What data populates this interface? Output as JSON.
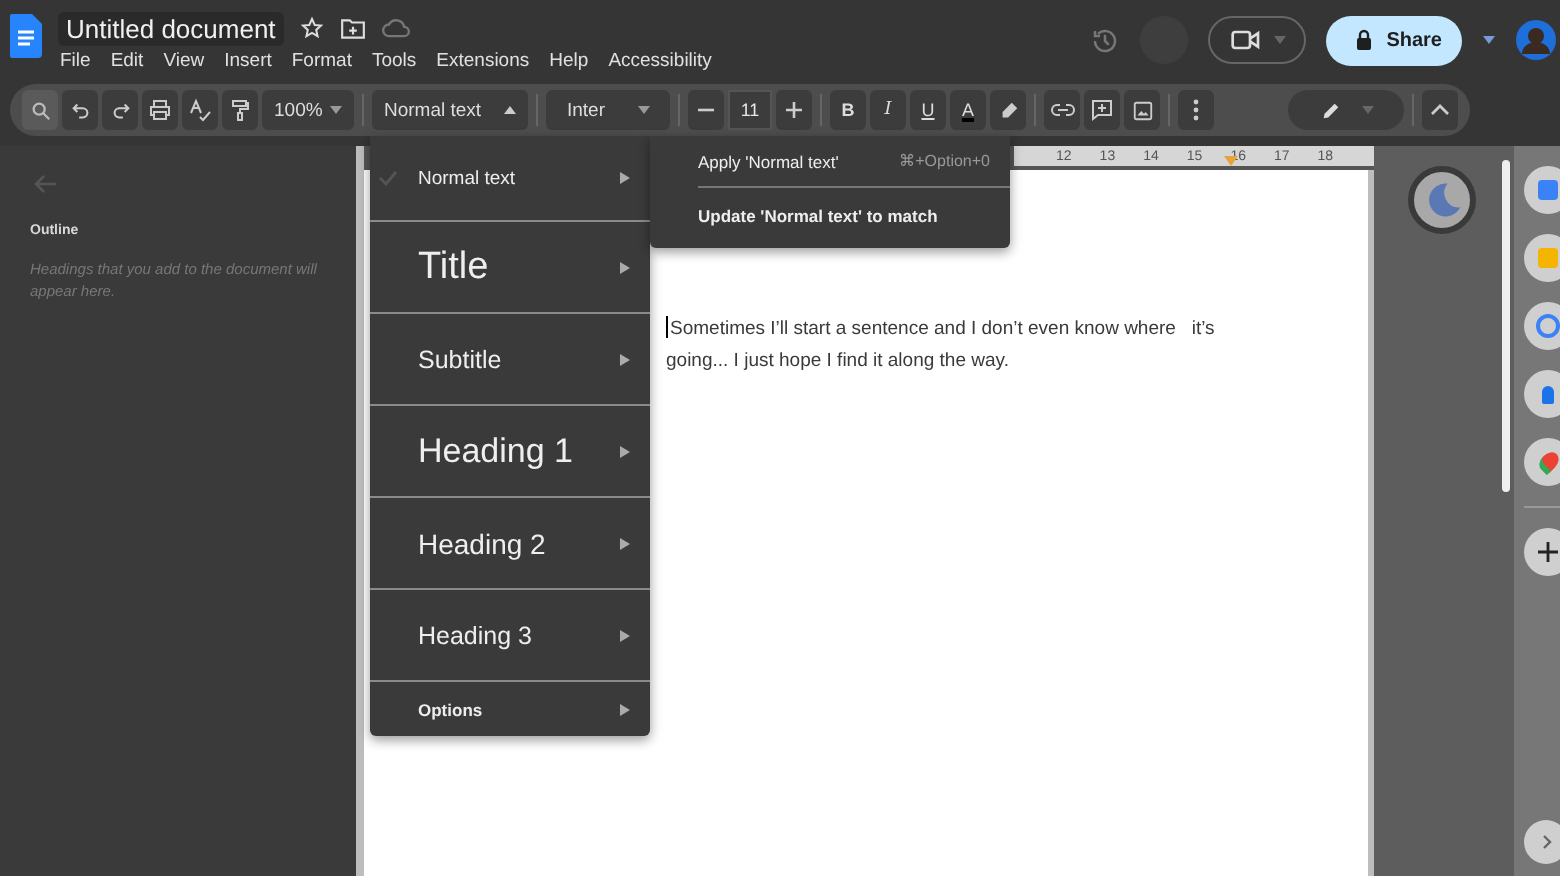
{
  "document": {
    "title": "Untitled document"
  },
  "menu_bar": [
    "File",
    "Edit",
    "View",
    "Insert",
    "Format",
    "Tools",
    "Extensions",
    "Help",
    "Accessibility"
  ],
  "share_button": "Share",
  "toolbar": {
    "zoom": "100%",
    "style": "Normal text",
    "font": "Inter",
    "font_size": "11",
    "format_buttons": [
      "B",
      "I",
      "U",
      "A"
    ]
  },
  "ruler": {
    "marks": [
      "12",
      "13",
      "14",
      "15",
      "16",
      "17",
      "18"
    ]
  },
  "outline": {
    "title": "Outline",
    "placeholder_text": "Headings that you add to the document will appear here."
  },
  "style_menu": {
    "items": [
      {
        "label": "Normal text",
        "kind": "normal",
        "checked": true
      },
      {
        "label": "Title",
        "kind": "title",
        "checked": false
      },
      {
        "label": "Subtitle",
        "kind": "subtitle",
        "checked": false
      },
      {
        "label": "Heading 1",
        "kind": "heading1",
        "checked": false
      },
      {
        "label": "Heading 2",
        "kind": "heading2",
        "checked": false
      },
      {
        "label": "Heading 3",
        "kind": "heading3",
        "checked": false
      },
      {
        "label": "Options",
        "kind": "options",
        "checked": false
      }
    ]
  },
  "style_submenu": [
    {
      "label": "Apply 'Normal text'",
      "kind": "apply",
      "shortcut": "⌘+Option+0"
    },
    {
      "label": "Update 'Normal text' to match",
      "kind": "update"
    }
  ],
  "body_text": {
    "lines": [
      "Sometimes I’ll start a sentence and I don’t even know where   it’s",
      "going... I just hope I find it along the way."
    ]
  }
}
